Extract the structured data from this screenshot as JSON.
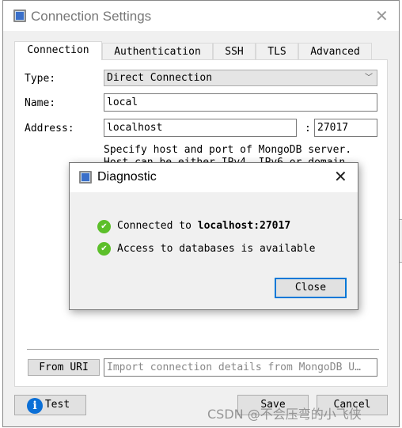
{
  "window": {
    "title": "Connection Settings",
    "close_icon": "close-icon"
  },
  "tabs": [
    {
      "label": "Connection",
      "active": true
    },
    {
      "label": "Authentication"
    },
    {
      "label": "SSH"
    },
    {
      "label": "TLS"
    },
    {
      "label": "Advanced"
    }
  ],
  "form": {
    "type_label": "Type:",
    "type_value": "Direct Connection",
    "name_label": "Name:",
    "name_value": "local",
    "address_label": "Address:",
    "host_value": "localhost",
    "colon": ":",
    "port_value": "27017",
    "help_line1": "Specify host and port of MongoDB server.",
    "help_line2": "Host can be either IPv4, IPv6 or domain"
  },
  "uri": {
    "button": "From URI",
    "placeholder": "Import connection details from MongoDB U…"
  },
  "footer": {
    "test": "Test",
    "save": "Save",
    "cancel": "Cancel"
  },
  "diagnostic": {
    "title": "Diagnostic",
    "line1_prefix": "Connected to ",
    "line1_host": "localhost:27017",
    "line2": "Access to databases is available",
    "close": "Close"
  },
  "watermark": "CSDN @不会压弯的小飞侠",
  "colors": {
    "accent": "#0078d7",
    "success": "#5cbf2a",
    "info": "#0b6fd6"
  }
}
